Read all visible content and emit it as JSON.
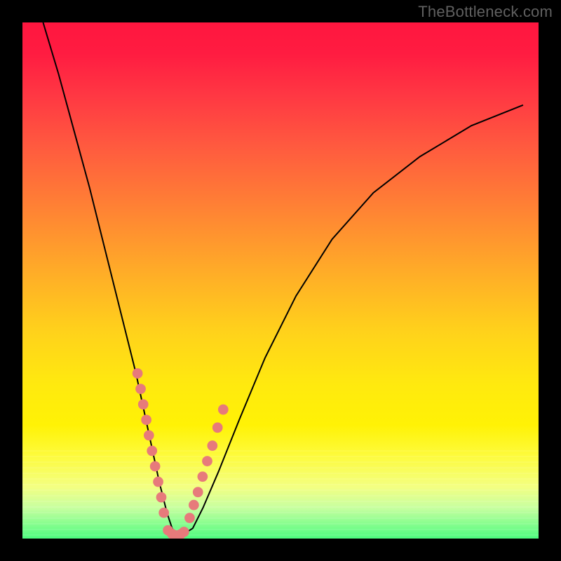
{
  "watermark": "TheBottleneck.com",
  "chart_data": {
    "type": "line",
    "title": "",
    "xlabel": "",
    "ylabel": "",
    "xlim": [
      0,
      100
    ],
    "ylim": [
      0,
      100
    ],
    "grid": false,
    "legend": false,
    "background": {
      "type": "vertical-gradient",
      "stops": [
        {
          "pos": 0,
          "color": "#ff163f"
        },
        {
          "pos": 24,
          "color": "#ff5a3f"
        },
        {
          "pos": 48,
          "color": "#ffab28"
        },
        {
          "pos": 70,
          "color": "#ffe90f"
        },
        {
          "pos": 90,
          "color": "#f3ff82"
        },
        {
          "pos": 100,
          "color": "#4dfc7f"
        }
      ]
    },
    "series": [
      {
        "name": "bottleneck-curve",
        "stroke": "#000000",
        "x": [
          4,
          7,
          10,
          13,
          16,
          18,
          20,
          22,
          23.5,
          25,
          26.5,
          28,
          29,
          30,
          31,
          33,
          35,
          38,
          42,
          47,
          53,
          60,
          68,
          77,
          87,
          97
        ],
        "y": [
          100,
          90,
          79,
          68,
          56,
          48,
          40,
          32,
          25,
          18,
          11,
          5,
          2,
          0.5,
          0.7,
          2,
          6,
          13,
          23,
          35,
          47,
          58,
          67,
          74,
          80,
          84
        ]
      }
    ],
    "markers": [
      {
        "name": "left-branch-dots",
        "color": "#e77a7b",
        "x": [
          22.3,
          22.9,
          23.4,
          24.0,
          24.5,
          25.1,
          25.7,
          26.3,
          26.9,
          27.4
        ],
        "y": [
          32,
          29,
          26,
          23,
          20,
          17,
          14,
          11,
          8,
          5
        ]
      },
      {
        "name": "trough-dots",
        "color": "#e77a7b",
        "x": [
          28.2,
          29.0,
          29.8,
          30.6,
          31.3
        ],
        "y": [
          1.6,
          0.9,
          0.6,
          0.8,
          1.3
        ]
      },
      {
        "name": "right-branch-dots",
        "color": "#e77a7b",
        "x": [
          32.4,
          33.2,
          34.0,
          34.9,
          35.8,
          36.8,
          37.8,
          38.9
        ],
        "y": [
          4,
          6.5,
          9,
          12,
          15,
          18,
          21.5,
          25
        ]
      }
    ],
    "annotations": []
  }
}
